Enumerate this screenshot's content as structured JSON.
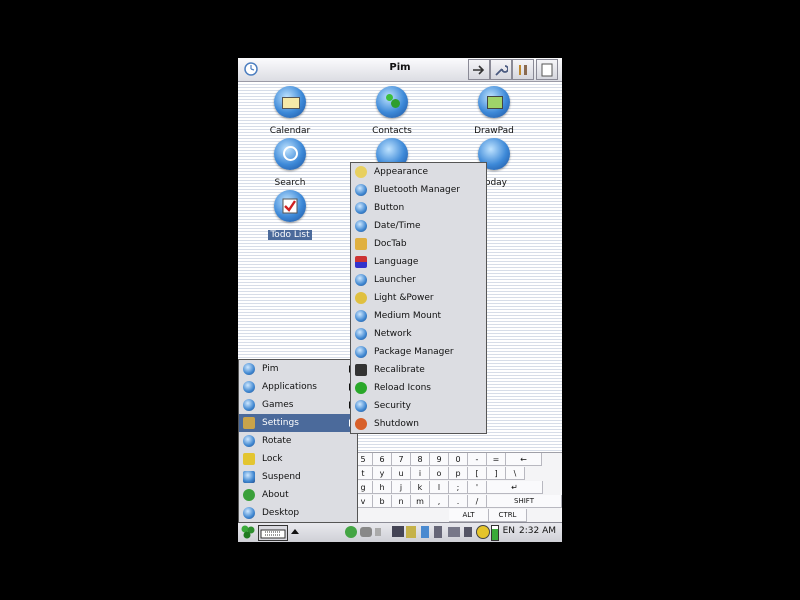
{
  "window": {
    "title": "Pim"
  },
  "apps": [
    {
      "label": "Calendar",
      "icon": "calendar-icon"
    },
    {
      "label": "Contacts",
      "icon": "contacts-icon"
    },
    {
      "label": "DrawPad",
      "icon": "drawpad-icon"
    },
    {
      "label": "Search",
      "icon": "search-icon"
    },
    {
      "label": "Today",
      "icon": "today-icon"
    },
    {
      "label": "Todo List",
      "icon": "todo-list-icon"
    }
  ],
  "start_menu": [
    {
      "label": "Pim",
      "icon": "pim-icon",
      "submenu": true
    },
    {
      "label": "Applications",
      "icon": "applications-icon",
      "submenu": true
    },
    {
      "label": "Games",
      "icon": "games-icon",
      "submenu": true
    },
    {
      "label": "Settings",
      "icon": "settings-icon",
      "submenu": true,
      "selected": true
    },
    {
      "label": "Rotate",
      "icon": "rotate-icon"
    },
    {
      "label": "Lock",
      "icon": "lock-icon"
    },
    {
      "label": "Suspend",
      "icon": "suspend-icon"
    },
    {
      "label": "About",
      "icon": "about-icon"
    },
    {
      "label": "Desktop",
      "icon": "desktop-icon"
    }
  ],
  "settings_menu": [
    {
      "label": "Appearance"
    },
    {
      "label": "Bluetooth Manager"
    },
    {
      "label": "Button"
    },
    {
      "label": "Date/Time"
    },
    {
      "label": "DocTab"
    },
    {
      "label": "Language"
    },
    {
      "label": "Launcher"
    },
    {
      "label": "Light &Power"
    },
    {
      "label": "Medium Mount"
    },
    {
      "label": "Network"
    },
    {
      "label": "Package Manager"
    },
    {
      "label": "Recalibrate"
    },
    {
      "label": "Reload Icons"
    },
    {
      "label": "Security"
    },
    {
      "label": "Shutdown"
    }
  ],
  "keyboard": {
    "row1": [
      "5",
      "6",
      "7",
      "8",
      "9",
      "0",
      "-",
      "=",
      "←"
    ],
    "row2": [
      "t",
      "y",
      "u",
      "i",
      "o",
      "p",
      "[",
      "]",
      "\\"
    ],
    "row3": [
      "g",
      "h",
      "j",
      "k",
      "l",
      ";",
      "'",
      "↵"
    ],
    "row4": [
      "v",
      "b",
      "n",
      "m",
      ",",
      ".",
      "/",
      "SHIFT"
    ],
    "row5": [
      "ALT",
      "CTRL"
    ]
  },
  "taskbar": {
    "language": "EN",
    "clock": "2:32 AM"
  }
}
